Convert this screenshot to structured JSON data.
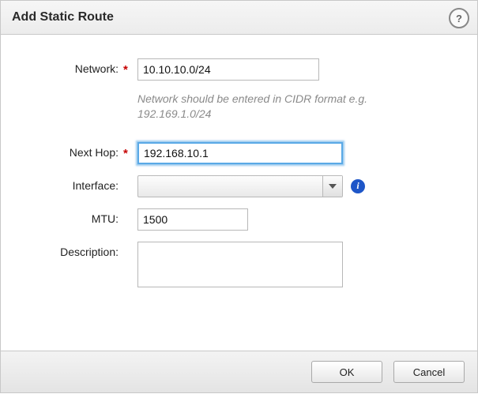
{
  "title": "Add Static Route",
  "required_glyph": "*",
  "help_glyph": "?",
  "info_glyph": "i",
  "fields": {
    "network": {
      "label": "Network:",
      "value": "10.10.10.0/24",
      "hint": "Network should be entered in CIDR format e.g. 192.169.1.0/24",
      "required": true
    },
    "nexthop": {
      "label": "Next Hop:",
      "value": "192.168.10.1",
      "required": true
    },
    "interface": {
      "label": "Interface:",
      "selected": ""
    },
    "mtu": {
      "label": "MTU:",
      "value": "1500"
    },
    "description": {
      "label": "Description:",
      "value": ""
    }
  },
  "buttons": {
    "ok": "OK",
    "cancel": "Cancel"
  }
}
